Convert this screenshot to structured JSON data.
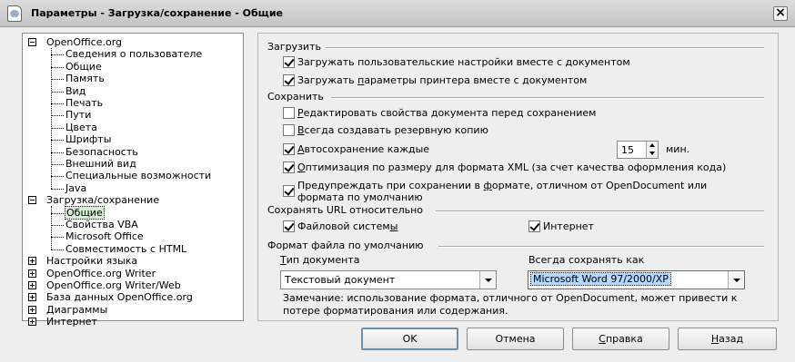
{
  "window": {
    "title": "Параметры - Загрузка/сохранение - Общие",
    "close_label": "×"
  },
  "tree": {
    "nodes": [
      {
        "label": "OpenOffice.org",
        "expanded": true,
        "children": [
          "Сведения о пользователе",
          "Общие",
          "Память",
          "Вид",
          "Печать",
          "Пути",
          "Цвета",
          "Шрифты",
          "Безопасность",
          "Внешний вид",
          "Специальные возможности",
          "Java"
        ]
      },
      {
        "label": "Загрузка/сохранение",
        "expanded": true,
        "children": [
          "Общие",
          "Свойства VBA",
          "Microsoft Office",
          "Совместимость с HTML"
        ]
      },
      {
        "label": "Настройки языка",
        "expanded": false,
        "children": []
      },
      {
        "label": "OpenOffice.org Writer",
        "expanded": false,
        "children": []
      },
      {
        "label": "OpenOffice.org Writer/Web",
        "expanded": false,
        "children": []
      },
      {
        "label": "База данных OpenOffice.org",
        "expanded": false,
        "children": []
      },
      {
        "label": "Диаграммы",
        "expanded": false,
        "children": []
      },
      {
        "label": "Интернет",
        "expanded": false,
        "children": []
      }
    ],
    "selected": "Загрузка/сохранение > Общие"
  },
  "load": {
    "heading": "Загрузить",
    "user_settings": {
      "label": "Загружать пользовательские настройки вместе с документом",
      "checked": true
    },
    "printer_settings_pre": "Загружать ",
    "printer_settings_ul": "п",
    "printer_settings_post": "араметры принтера вместе с документом",
    "printer_settings_checked": true
  },
  "save": {
    "heading": "Сохранить",
    "edit_props": {
      "pre": "",
      "ul": "Р",
      "post": "едактировать свойства документа перед сохранением",
      "checked": false
    },
    "backup": {
      "pre": "",
      "ul": "В",
      "post": "сегда создавать резервную копию",
      "checked": false
    },
    "autosave": {
      "pre": "",
      "ul": "А",
      "post": "втосохранение каждые",
      "checked": true,
      "value": "15",
      "unit": "мин."
    },
    "xml_opt": {
      "pre": "",
      "ul": "О",
      "post": "птимизация по размеру для формата XML (за счет качества оформления кода)",
      "checked": true
    },
    "warn_format_line1_pre": "Предупреждать при сохранении в ",
    "warn_format_line1_ul": "ф",
    "warn_format_line1_post": "ормате, отличном от OpenDocument или",
    "warn_format_line2": "формата по умолчанию",
    "warn_format_checked": true
  },
  "relative_urls": {
    "heading": "Сохранять URL относительно",
    "filesystem_pre": "Файловой систем",
    "filesystem_ul": "ы",
    "filesystem_checked": true,
    "internet_label": "Интернет",
    "internet_checked": true
  },
  "default_format": {
    "heading": "Формат файла по умолчанию",
    "doc_type_label": "Тип документа",
    "doc_type_value": "Текстовый документ",
    "always_save_label": "Всегда сохранять как",
    "always_save_value": "Microsoft Word 97/2000/XP",
    "note_line1": "Замечание: использование формата, отличного от OpenDocument, может привести к",
    "note_line2": "потере форматирования или содержания."
  },
  "buttons": {
    "ok": "OK",
    "cancel": "Отмена",
    "help_ul": "С",
    "help_post": "правка",
    "back_ul": "Н",
    "back_post": "азад"
  }
}
